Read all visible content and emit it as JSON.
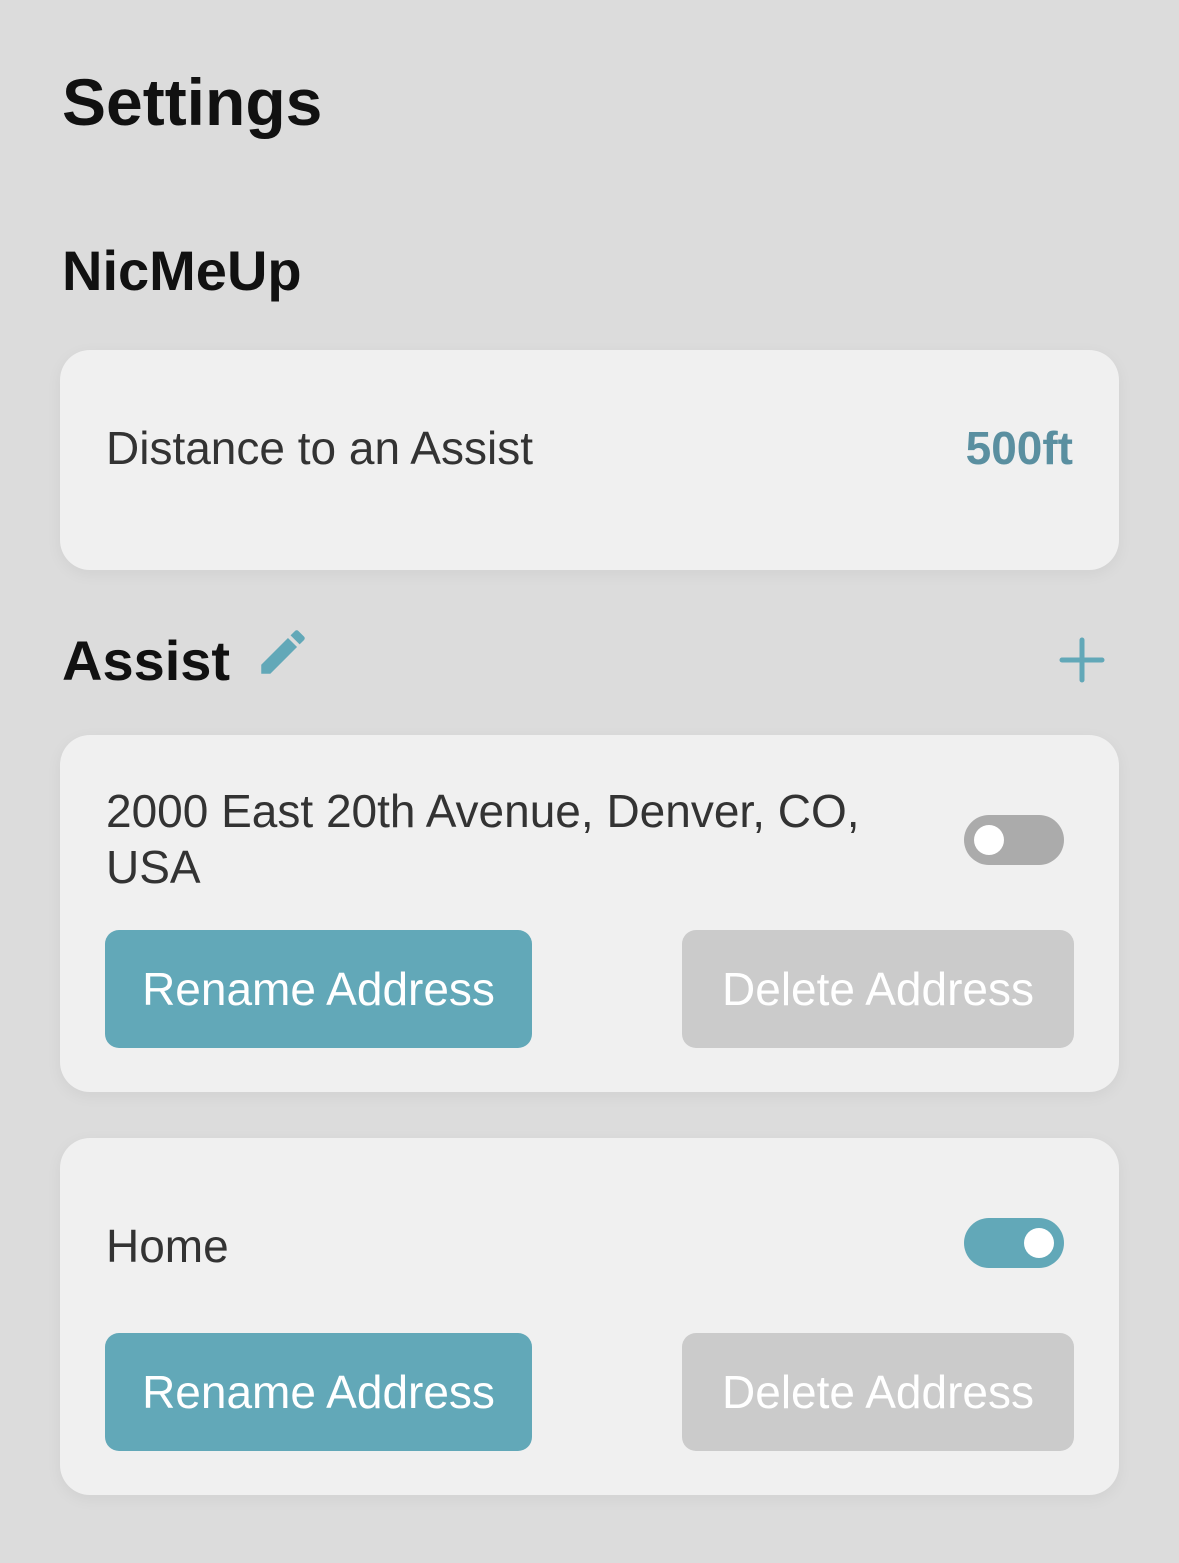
{
  "header": {
    "title": "Settings"
  },
  "nicmeup": {
    "section_title": "NicMeUp",
    "distance_label": "Distance to an Assist",
    "distance_value": "500ft"
  },
  "assist": {
    "section_title": "Assist",
    "edit_icon": "pencil-icon",
    "add_icon": "plus-icon",
    "addresses": [
      {
        "name": "2000 East 20th Avenue, Denver, CO, USA",
        "enabled": false,
        "rename_label": "Rename Address",
        "delete_label": "Delete Address"
      },
      {
        "name": "Home",
        "enabled": true,
        "rename_label": "Rename Address",
        "delete_label": "Delete Address"
      }
    ]
  },
  "colors": {
    "background": "#dcdcdc",
    "card": "#f0f0f0",
    "accent": "#62a8b8",
    "accent_text": "#5a8fa0",
    "toggle_off": "#ababab",
    "button_disabled": "#cbcbcb"
  }
}
